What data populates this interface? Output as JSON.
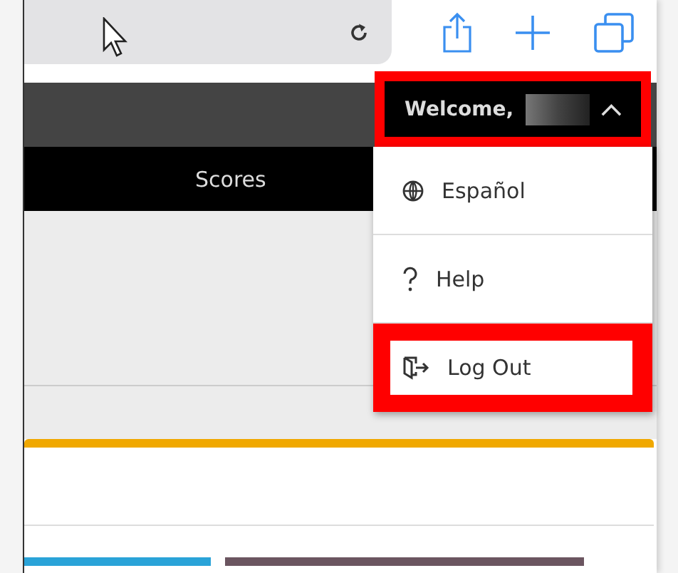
{
  "browser_toolbar": {
    "address_bar": {
      "reload": true
    }
  },
  "header": {
    "welcome_menu": {
      "label": "Welcome,",
      "expanded": true,
      "highlighted": true
    }
  },
  "nav": {
    "tabs": [
      {
        "label": "Scores"
      }
    ]
  },
  "user_menu": {
    "items": [
      {
        "kind": "language",
        "label": "Español",
        "highlighted": false
      },
      {
        "kind": "help",
        "label": "Help",
        "highlighted": false
      },
      {
        "kind": "logout",
        "label": "Log Out",
        "highlighted": true
      }
    ]
  }
}
